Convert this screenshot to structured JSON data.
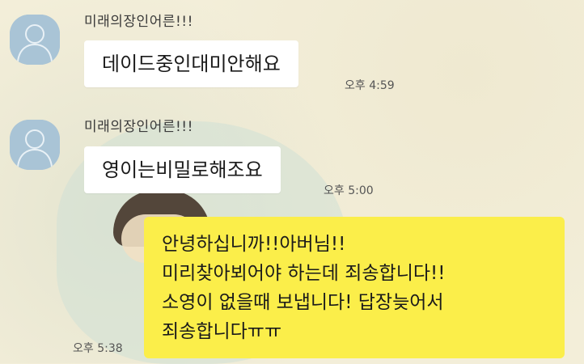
{
  "chat": {
    "messages": [
      {
        "sender": "미래의장인어른!!!",
        "text": "데이드중인대미안해요",
        "time": "오후 4:59"
      },
      {
        "sender": "미래의장인어른!!!",
        "text": "영이는비밀로해조요",
        "time": "오후 5:00"
      }
    ],
    "reply": {
      "lines": [
        "안녕하십니까!!아버님!!",
        "미리찾아뵈어야 하는데 죄송합니다!!",
        "소영이 없을때 보냅니다! 답장늦어서",
        "죄송합니다ㅠㅠ"
      ],
      "time": "오후 5:38"
    }
  },
  "colors": {
    "background": "#f3eed9",
    "incoming_bubble": "#ffffff",
    "outgoing_bubble": "#fbee4a",
    "avatar": "#a9c4d6"
  },
  "icons": {
    "avatar": "default-profile-icon"
  }
}
